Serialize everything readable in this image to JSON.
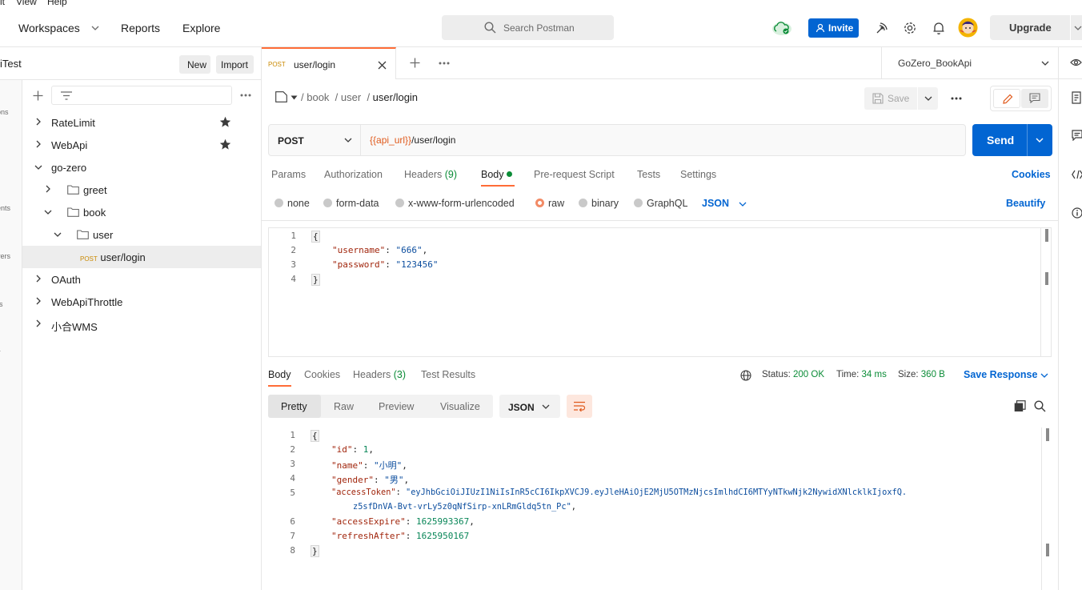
{
  "menubar": {
    "items": [
      "it",
      "View",
      "Help"
    ]
  },
  "header": {
    "workspaces": "Workspaces",
    "reports": "Reports",
    "explore": "Explore",
    "search_placeholder": "Search Postman",
    "invite": "Invite",
    "upgrade": "Upgrade"
  },
  "sidebar": {
    "workspace_name": "iTest",
    "new_button": "New",
    "import_button": "Import",
    "rail_labels": [
      "ons",
      "ents",
      "vers",
      "rs",
      "y"
    ],
    "tree": [
      {
        "label": "RateLimit",
        "starred": true
      },
      {
        "label": "WebApi",
        "starred": true
      },
      {
        "label": "go-zero"
      },
      {
        "label": "greet"
      },
      {
        "label": "book"
      },
      {
        "label": "user"
      },
      {
        "method": "POST",
        "label": "user/login"
      },
      {
        "label": "OAuth"
      },
      {
        "label": "WebApiThrottle"
      },
      {
        "label": "小合WMS"
      }
    ]
  },
  "tabbar": {
    "active_tab": {
      "method": "POST",
      "title": "user/login"
    },
    "environment": "GoZero_BookApi"
  },
  "request": {
    "breadcrumb": [
      "book",
      "user",
      "user/login"
    ],
    "save_label": "Save",
    "method": "POST",
    "url_var": "{{api_url}}",
    "url_path": "/user/login",
    "send_label": "Send",
    "tabs": {
      "params": "Params",
      "authorization": "Authorization",
      "headers": "Headers",
      "headers_count": "(9)",
      "body": "Body",
      "pre_request": "Pre-request Script",
      "tests": "Tests",
      "settings": "Settings"
    },
    "cookies": "Cookies",
    "body_types": {
      "none": "none",
      "form_data": "form-data",
      "urlencoded": "x-www-form-urlencoded",
      "raw": "raw",
      "binary": "binary",
      "graphql": "GraphQL"
    },
    "body_language": "JSON",
    "beautify": "Beautify",
    "body_lines": {
      "l1": "{",
      "username_key": "\"username\"",
      "username_val": "\"666\"",
      "password_key": "\"password\"",
      "password_val": "\"123456\"",
      "l4": "}"
    },
    "line_numbers": [
      "1",
      "2",
      "3",
      "4"
    ]
  },
  "response": {
    "tabs": {
      "body": "Body",
      "cookies": "Cookies",
      "headers": "Headers",
      "headers_count": "(3)",
      "test_results": "Test Results"
    },
    "status_label": "Status:",
    "status_value": "200 OK",
    "time_label": "Time:",
    "time_value": "34 ms",
    "size_label": "Size:",
    "size_value": "360 B",
    "save_response": "Save Response",
    "views": {
      "pretty": "Pretty",
      "raw": "Raw",
      "preview": "Preview",
      "visualize": "Visualize"
    },
    "format": "JSON",
    "line_numbers": [
      "1",
      "2",
      "3",
      "4",
      "5",
      "6",
      "7",
      "8"
    ],
    "body": {
      "open": "{",
      "id_key": "\"id\"",
      "id_val": "1",
      "name_key": "\"name\"",
      "name_val": "\"小明\"",
      "gender_key": "\"gender\"",
      "gender_val": "\"男\"",
      "token_key": "\"accessToken\"",
      "token_val_1": "\"eyJhbGciOiJIUzI1NiIsInR5cCI6IkpXVCJ9.eyJleHAiOjE2MjU5OTMzNjcsImlhdCI6MTYyNTkwNjk2NywidXNlcklkIjoxfQ.",
      "token_val_2": "z5sfDnVA-Bvt-vrLy5z0qNfSirp-xnLRmGldq5tn_Pc\"",
      "expire_key": "\"accessExpire\"",
      "expire_val": "1625993367",
      "refresh_key": "\"refreshAfter\"",
      "refresh_val": "1625950167",
      "close": "}"
    }
  },
  "colors": {
    "accent": "#ff6c37",
    "primary": "#0265d2",
    "success": "#0b8c37"
  }
}
